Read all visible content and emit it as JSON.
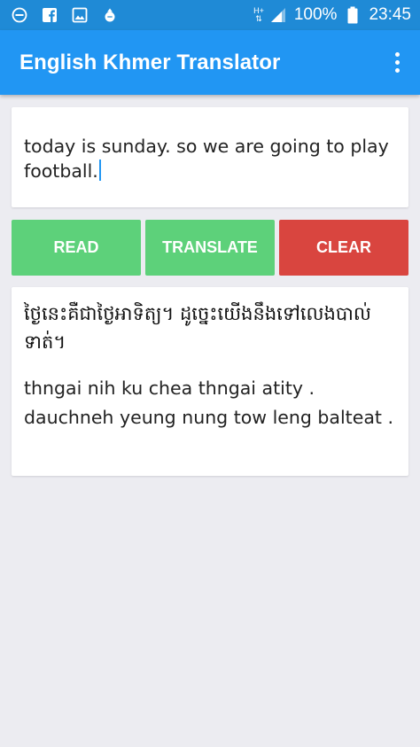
{
  "status_bar": {
    "network_type": "H+",
    "battery_percent": "100%",
    "time": "23:45",
    "left_icons": [
      "minus-circle-icon",
      "facebook-icon",
      "image-icon",
      "notification-icon"
    ],
    "right_icons": [
      "signal-icon",
      "battery-icon"
    ]
  },
  "app_bar": {
    "title": "English Khmer Translator",
    "menu_icon": "more-vert-icon"
  },
  "input": {
    "text": "today is sunday. so we are going to play football."
  },
  "buttons": {
    "read": "READ",
    "translate": "TRANSLATE",
    "clear": "CLEAR"
  },
  "output": {
    "khmer": "ថ្ងៃនេះគឺជាថ្ងៃអាទិត្យ។ ដូច្នេះយើងនឹងទៅលេងបាល់ទាត់។",
    "romanized": "thngai nih ku chea thngai atity . dauchneh yeung nung tow leng balteat ."
  },
  "colors": {
    "status_bar": "#1f8ad6",
    "app_bar": "#2196f3",
    "button_green": "#5dd17a",
    "button_red": "#d9453f",
    "background": "#ececf1"
  }
}
